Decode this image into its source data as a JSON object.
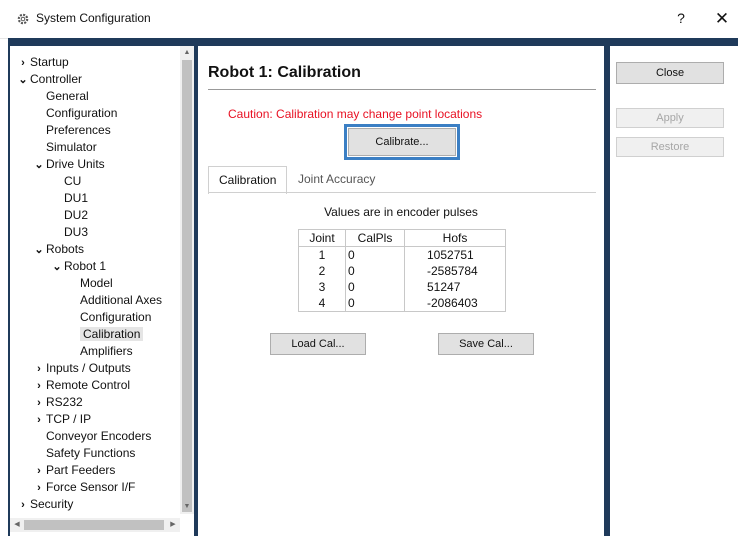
{
  "window": {
    "title": "System Configuration",
    "help": "?",
    "close": "✕"
  },
  "tree": [
    {
      "label": "Startup",
      "chev": "›",
      "indent": 0
    },
    {
      "label": "Controller",
      "chev": "⌄",
      "indent": 0
    },
    {
      "label": "General",
      "chev": "",
      "indent": 1
    },
    {
      "label": "Configuration",
      "chev": "",
      "indent": 1
    },
    {
      "label": "Preferences",
      "chev": "",
      "indent": 1
    },
    {
      "label": "Simulator",
      "chev": "",
      "indent": 1
    },
    {
      "label": "Drive Units",
      "chev": "⌄",
      "indent": 1
    },
    {
      "label": "CU",
      "chev": "",
      "indent": 2
    },
    {
      "label": "DU1",
      "chev": "",
      "indent": 2
    },
    {
      "label": "DU2",
      "chev": "",
      "indent": 2
    },
    {
      "label": "DU3",
      "chev": "",
      "indent": 2
    },
    {
      "label": "Robots",
      "chev": "⌄",
      "indent": 1
    },
    {
      "label": "Robot 1",
      "chev": "⌄",
      "indent": 2
    },
    {
      "label": "Model",
      "chev": "",
      "indent": 3
    },
    {
      "label": "Additional Axes",
      "chev": "",
      "indent": 3
    },
    {
      "label": "Configuration",
      "chev": "",
      "indent": 3
    },
    {
      "label": "Calibration",
      "chev": "",
      "indent": 3,
      "selected": true
    },
    {
      "label": "Amplifiers",
      "chev": "",
      "indent": 3
    },
    {
      "label": "Inputs / Outputs",
      "chev": "›",
      "indent": 1
    },
    {
      "label": "Remote Control",
      "chev": "›",
      "indent": 1
    },
    {
      "label": "RS232",
      "chev": "›",
      "indent": 1
    },
    {
      "label": "TCP / IP",
      "chev": "›",
      "indent": 1
    },
    {
      "label": "Conveyor Encoders",
      "chev": "",
      "indent": 1
    },
    {
      "label": "Safety Functions",
      "chev": "",
      "indent": 1
    },
    {
      "label": "Part Feeders",
      "chev": "›",
      "indent": 1
    },
    {
      "label": "Force Sensor I/F",
      "chev": "›",
      "indent": 1
    },
    {
      "label": "Security",
      "chev": "›",
      "indent": 0
    }
  ],
  "main": {
    "title": "Robot 1: Calibration",
    "caution": "Caution: Calibration may change point locations",
    "calibrate_label": "Calibrate...",
    "tabs": [
      "Calibration",
      "Joint Accuracy"
    ],
    "note": "Values are in encoder pulses",
    "table": {
      "headers": [
        "Joint",
        "CalPls",
        "Hofs"
      ],
      "rows": [
        [
          "1",
          "0",
          "1052751"
        ],
        [
          "2",
          "0",
          "-2585784"
        ],
        [
          "3",
          "0",
          "51247"
        ],
        [
          "4",
          "0",
          "-2086403"
        ]
      ]
    },
    "load_label": "Load Cal...",
    "save_label": "Save Cal..."
  },
  "actions": {
    "close": "Close",
    "apply": "Apply",
    "restore": "Restore"
  },
  "colors": {
    "caution": "#e81123",
    "focus_border": "#3b7fc4",
    "frame": "#1f3a5a"
  }
}
